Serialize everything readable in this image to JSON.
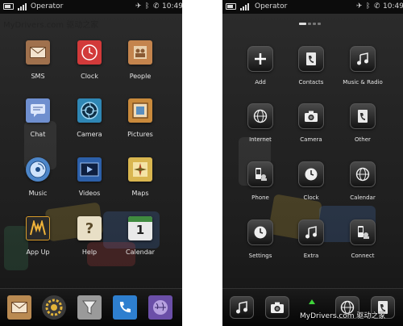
{
  "left_screen": {
    "status": {
      "carrier": "Operator",
      "time": "10:49"
    },
    "watermark": "MyDrivers.com 驱动之家",
    "apps": [
      {
        "label": "SMS",
        "icon": "envelope-icon",
        "color": "#a0714d"
      },
      {
        "label": "Clock",
        "icon": "clock-icon",
        "color": "#d23a3a"
      },
      {
        "label": "People",
        "icon": "people-icon",
        "color": "#c4844d"
      },
      {
        "label": "Chat",
        "icon": "chat-icon",
        "color": "#6f8fcf"
      },
      {
        "label": "Camera",
        "icon": "camera-aperture-icon",
        "color": "#2f87b5"
      },
      {
        "label": "Pictures",
        "icon": "picture-frame-icon",
        "color": "#c98a3c"
      },
      {
        "label": "Music",
        "icon": "music-disc-icon",
        "color": "#4d86c9"
      },
      {
        "label": "Videos",
        "icon": "video-play-icon",
        "color": "#2c5fa8"
      },
      {
        "label": "Maps",
        "icon": "map-compass-icon",
        "color": "#d9b650"
      },
      {
        "label": "App Up",
        "icon": "app-up-icon",
        "color": "#2a2a2a"
      },
      {
        "label": "Help",
        "icon": "help-question-icon",
        "color": "#e8dfc6"
      },
      {
        "label": "Calendar",
        "icon": "calendar-icon",
        "color": "#e9e9e9"
      }
    ],
    "calendar_day": "1",
    "help_glyph": "?",
    "dock": [
      {
        "icon": "mail-icon",
        "color": "#b98a52"
      },
      {
        "icon": "settings-gear-icon",
        "color": "#3a3a3a"
      },
      {
        "icon": "filter-funnel-icon",
        "color": "#9a9a9a"
      },
      {
        "icon": "phone-icon",
        "color": "#2e7fcf"
      },
      {
        "icon": "world-globe-icon",
        "color": "#6b4fa8"
      }
    ]
  },
  "right_screen": {
    "status": {
      "carrier": "Operator",
      "time": "10:49"
    },
    "watermark": "MyDrivers.com 驱动之家",
    "apps": [
      {
        "label": "Add",
        "icon": "plus-icon"
      },
      {
        "label": "Contacts",
        "icon": "contacts-book-icon"
      },
      {
        "label": "Music & Radio",
        "icon": "music-note-icon"
      },
      {
        "label": "Internet",
        "icon": "globe-icon"
      },
      {
        "label": "Camera",
        "icon": "camera-icon"
      },
      {
        "label": "Other",
        "icon": "other-book-icon"
      },
      {
        "label": "Phone",
        "icon": "phone-device-icon"
      },
      {
        "label": "Clock",
        "icon": "clock-icon"
      },
      {
        "label": "Calendar",
        "icon": "calendar-globe-icon"
      },
      {
        "label": "Settings",
        "icon": "settings-clock-icon"
      },
      {
        "label": "Extra",
        "icon": "extra-music-icon"
      },
      {
        "label": "Connect",
        "icon": "connect-device-icon"
      }
    ],
    "dock": [
      {
        "icon": "music-note-icon"
      },
      {
        "icon": "camera-icon"
      },
      {
        "icon": "globe-icon"
      },
      {
        "icon": "contacts-book-icon"
      }
    ],
    "accent": "#3fd43a"
  }
}
